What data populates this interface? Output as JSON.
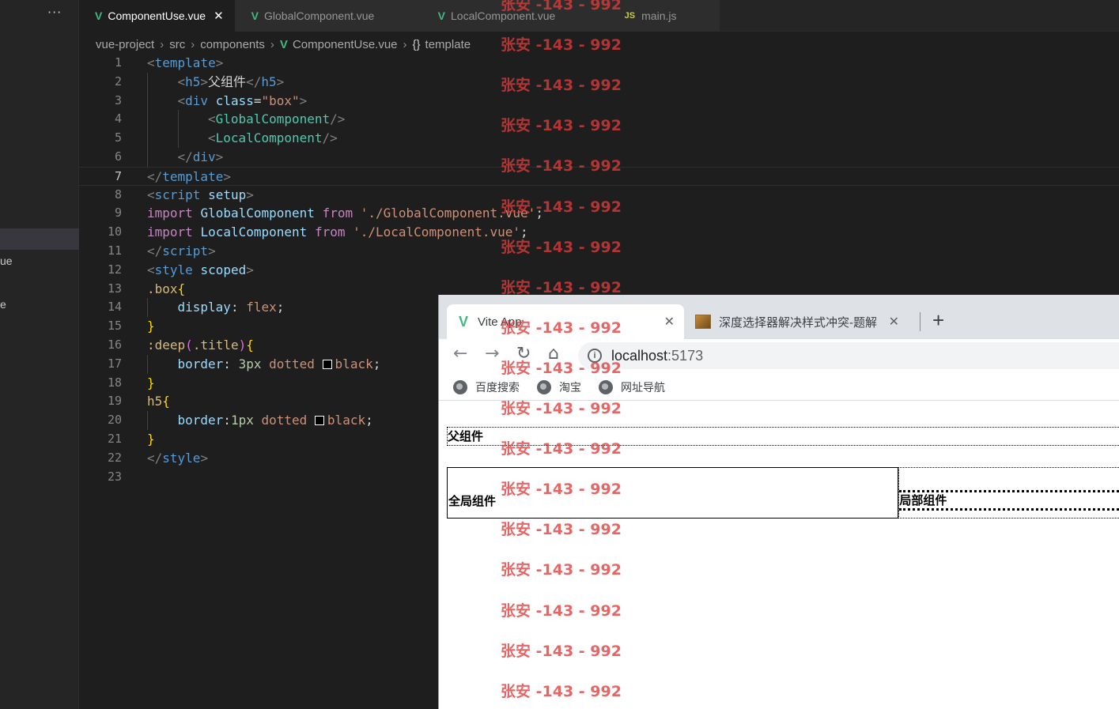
{
  "editor": {
    "more_label": "···",
    "sidebar_fragments": [
      "ue",
      "e"
    ],
    "tabs": [
      {
        "label": "ComponentUse.vue",
        "icon": "vue-icon",
        "close": "✕",
        "active": true
      },
      {
        "label": "GlobalComponent.vue",
        "icon": "vue-icon",
        "close": "",
        "active": false
      },
      {
        "label": "LocalComponent.vue",
        "icon": "vue-icon",
        "close": "",
        "active": false
      },
      {
        "label": "main.js",
        "icon": "js-icon",
        "close": "",
        "active": false
      }
    ],
    "breadcrumb": {
      "project": "vue-project",
      "src": "src",
      "components": "components",
      "file": "ComponentUse.vue",
      "symbol_icon": "{}",
      "symbol": "template",
      "separator": "›"
    },
    "current_line": 7,
    "lines": [
      {
        "n": "1",
        "indent": 0,
        "tokens": [
          [
            "c-punc",
            "<"
          ],
          [
            "c-tag",
            "template"
          ],
          [
            "c-punc",
            ">"
          ]
        ]
      },
      {
        "n": "2",
        "indent": 1,
        "tokens": [
          [
            "c-punc",
            "<"
          ],
          [
            "c-tag",
            "h5"
          ],
          [
            "c-punc",
            ">"
          ],
          [
            "c-plain",
            "父组件"
          ],
          [
            "c-punc",
            "</"
          ],
          [
            "c-tag",
            "h5"
          ],
          [
            "c-punc",
            ">"
          ]
        ]
      },
      {
        "n": "3",
        "indent": 1,
        "tokens": [
          [
            "c-punc",
            "<"
          ],
          [
            "c-tag",
            "div"
          ],
          [
            "c-plain",
            " "
          ],
          [
            "c-attr",
            "class"
          ],
          [
            "c-plain",
            "="
          ],
          [
            "c-str",
            "\"box\""
          ],
          [
            "c-punc",
            ">"
          ]
        ]
      },
      {
        "n": "4",
        "indent": 2,
        "tokens": [
          [
            "c-punc",
            "<"
          ],
          [
            "c-comp",
            "GlobalComponent"
          ],
          [
            "c-punc",
            "/>"
          ]
        ]
      },
      {
        "n": "5",
        "indent": 2,
        "tokens": [
          [
            "c-punc",
            "<"
          ],
          [
            "c-comp",
            "LocalComponent"
          ],
          [
            "c-punc",
            "/>"
          ]
        ]
      },
      {
        "n": "6",
        "indent": 1,
        "tokens": [
          [
            "c-punc",
            "</"
          ],
          [
            "c-tag",
            "div"
          ],
          [
            "c-punc",
            ">"
          ]
        ]
      },
      {
        "n": "7",
        "indent": 0,
        "tokens": [
          [
            "c-punc",
            "</"
          ],
          [
            "c-tag",
            "template"
          ],
          [
            "c-punc",
            ">"
          ]
        ]
      },
      {
        "n": "8",
        "indent": 0,
        "tokens": [
          [
            "c-punc",
            "<"
          ],
          [
            "c-tag",
            "script"
          ],
          [
            "c-plain",
            " "
          ],
          [
            "c-attr",
            "setup"
          ],
          [
            "c-punc",
            ">"
          ]
        ]
      },
      {
        "n": "9",
        "indent": 0,
        "tokens": [
          [
            "c-kw",
            "import"
          ],
          [
            "c-plain",
            " "
          ],
          [
            "c-attr",
            "GlobalComponent"
          ],
          [
            "c-plain",
            " "
          ],
          [
            "c-kw",
            "from"
          ],
          [
            "c-plain",
            " "
          ],
          [
            "c-str",
            "'./GlobalComponent.vue'"
          ],
          [
            "c-plain",
            ";"
          ]
        ]
      },
      {
        "n": "10",
        "indent": 0,
        "tokens": [
          [
            "c-kw",
            "import"
          ],
          [
            "c-plain",
            " "
          ],
          [
            "c-attr",
            "LocalComponent"
          ],
          [
            "c-plain",
            " "
          ],
          [
            "c-kw",
            "from"
          ],
          [
            "c-plain",
            " "
          ],
          [
            "c-str",
            "'./LocalComponent.vue'"
          ],
          [
            "c-plain",
            ";"
          ]
        ]
      },
      {
        "n": "11",
        "indent": 0,
        "tokens": [
          [
            "c-punc",
            "</"
          ],
          [
            "c-tag",
            "script"
          ],
          [
            "c-punc",
            ">"
          ]
        ]
      },
      {
        "n": "12",
        "indent": 0,
        "tokens": [
          [
            "c-punc",
            "<"
          ],
          [
            "c-tag",
            "style"
          ],
          [
            "c-plain",
            " "
          ],
          [
            "c-attr",
            "scoped"
          ],
          [
            "c-punc",
            ">"
          ]
        ]
      },
      {
        "n": "13",
        "indent": 0,
        "tokens": [
          [
            "c-sel",
            ".box"
          ],
          [
            "c-brace",
            "{"
          ]
        ]
      },
      {
        "n": "14",
        "indent": 1,
        "tokens": [
          [
            "c-prop",
            "display"
          ],
          [
            "c-plain",
            ": "
          ],
          [
            "c-val",
            "flex"
          ],
          [
            "c-plain",
            ";"
          ]
        ]
      },
      {
        "n": "15",
        "indent": 0,
        "tokens": [
          [
            "c-brace",
            "}"
          ]
        ]
      },
      {
        "n": "16",
        "indent": 0,
        "tokens": [
          [
            "c-sel",
            ":deep"
          ],
          [
            "c-paren",
            "("
          ],
          [
            "c-sel",
            ".title"
          ],
          [
            "c-paren",
            ")"
          ],
          [
            "c-brace",
            "{"
          ]
        ]
      },
      {
        "n": "17",
        "indent": 1,
        "tokens": [
          [
            "c-prop",
            "border"
          ],
          [
            "c-plain",
            ": "
          ],
          [
            "c-num",
            "3px"
          ],
          [
            "c-plain",
            " "
          ],
          [
            "c-val",
            "dotted"
          ],
          [
            "c-plain",
            " "
          ],
          [
            "swatch",
            ""
          ],
          [
            "c-val",
            "black"
          ],
          [
            "c-plain",
            ";"
          ]
        ]
      },
      {
        "n": "18",
        "indent": 0,
        "tokens": [
          [
            "c-brace",
            "}"
          ]
        ]
      },
      {
        "n": "19",
        "indent": 0,
        "tokens": [
          [
            "c-sel",
            "h5"
          ],
          [
            "c-brace",
            "{"
          ]
        ]
      },
      {
        "n": "20",
        "indent": 1,
        "tokens": [
          [
            "c-prop",
            "border"
          ],
          [
            "c-plain",
            ":"
          ],
          [
            "c-num",
            "1px"
          ],
          [
            "c-plain",
            " "
          ],
          [
            "c-val",
            "dotted"
          ],
          [
            "c-plain",
            " "
          ],
          [
            "swatch",
            ""
          ],
          [
            "c-val",
            "black"
          ],
          [
            "c-plain",
            ";"
          ]
        ]
      },
      {
        "n": "21",
        "indent": 0,
        "tokens": [
          [
            "c-brace",
            "}"
          ]
        ]
      },
      {
        "n": "22",
        "indent": 0,
        "tokens": [
          [
            "c-punc",
            "</"
          ],
          [
            "c-tag",
            "style"
          ],
          [
            "c-punc",
            ">"
          ]
        ]
      },
      {
        "n": "23",
        "indent": 0,
        "tokens": []
      }
    ]
  },
  "browser": {
    "tabs": [
      {
        "title": "Vite App",
        "icon": "vue-icon",
        "close": "✕"
      },
      {
        "title": "深度选择器解决样式冲突-题解",
        "icon": "page-favicon-icon",
        "close": "✕"
      }
    ],
    "new_tab": "+",
    "nav": {
      "back": "←",
      "forward": "→",
      "reload": "↻",
      "home": "⌂"
    },
    "address": {
      "host": "localhost",
      "port": ":5173",
      "info_icon": "i"
    },
    "bookmarks": [
      "百度搜索",
      "淘宝",
      "网址导航"
    ],
    "page": {
      "parent_heading": "父组件",
      "global_component": "全局组件",
      "local_component": "局部组件"
    }
  },
  "watermark": {
    "text": "张安 -143 - 992",
    "count": 18
  },
  "colors": {
    "editor_bg": "#1e1e1e",
    "vue_green": "#41b883",
    "watermark": "#dd3c3c"
  }
}
